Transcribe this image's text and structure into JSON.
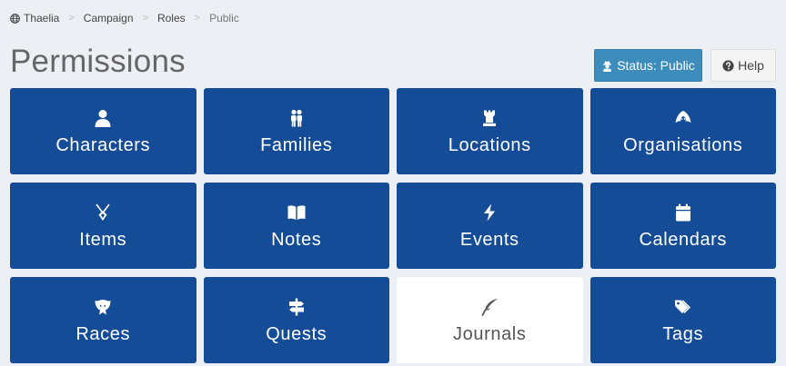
{
  "breadcrumb": {
    "items": [
      {
        "label": "Thaelia",
        "icon": "globe-icon"
      },
      {
        "label": "Campaign"
      },
      {
        "label": "Roles"
      },
      {
        "label": "Public"
      }
    ],
    "separator": ">"
  },
  "page": {
    "title": "Permissions"
  },
  "actions": {
    "status_label": "Status: Public",
    "status_icon": "user-secret-icon",
    "help_label": "Help",
    "help_icon": "question-circle-icon"
  },
  "colors": {
    "tile_active": "#154c97",
    "tile_inactive": "#ffffff",
    "status_button": "#3c8dbc",
    "background": "#ecf0f5"
  },
  "modules": [
    {
      "label": "Characters",
      "icon": "user-icon",
      "enabled": true
    },
    {
      "label": "Families",
      "icon": "users-icon",
      "enabled": true
    },
    {
      "label": "Locations",
      "icon": "chess-rook-icon",
      "enabled": true
    },
    {
      "label": "Organisations",
      "icon": "hood-icon",
      "enabled": true
    },
    {
      "label": "Items",
      "icon": "necklace-icon",
      "enabled": true
    },
    {
      "label": "Notes",
      "icon": "book-open-icon",
      "enabled": true
    },
    {
      "label": "Events",
      "icon": "bolt-icon",
      "enabled": true
    },
    {
      "label": "Calendars",
      "icon": "calendar-icon",
      "enabled": true
    },
    {
      "label": "Races",
      "icon": "dragon-icon",
      "enabled": true
    },
    {
      "label": "Quests",
      "icon": "signpost-icon",
      "enabled": true
    },
    {
      "label": "Journals",
      "icon": "quill-icon",
      "enabled": false
    },
    {
      "label": "Tags",
      "icon": "tags-icon",
      "enabled": true
    }
  ]
}
